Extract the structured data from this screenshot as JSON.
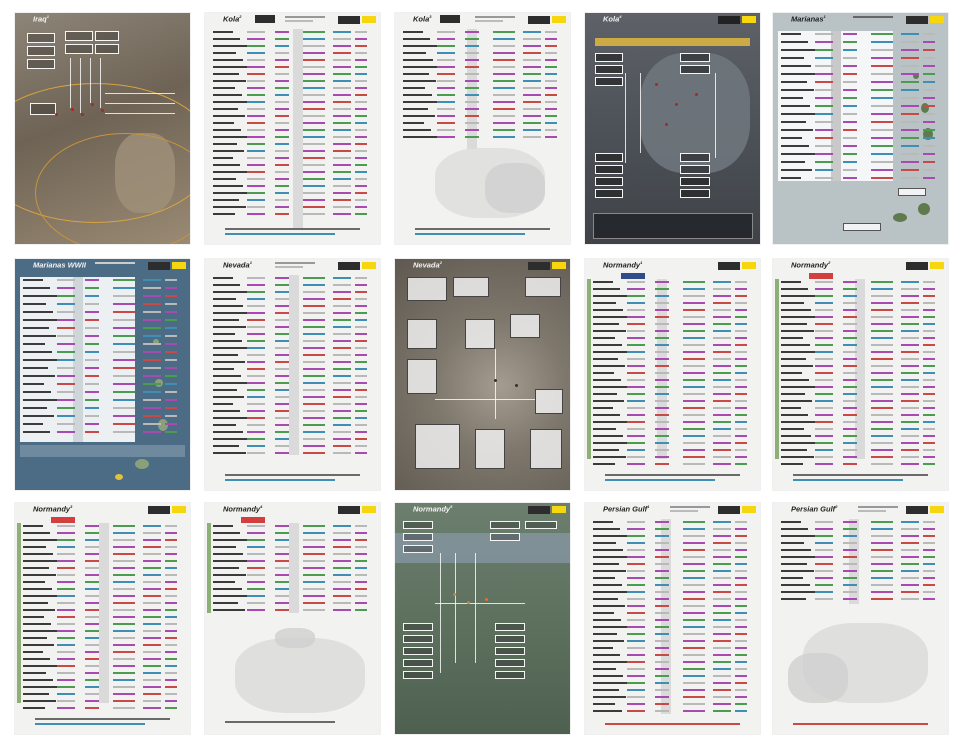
{
  "pages": [
    {
      "num": "",
      "title": "Iraq",
      "mark": "1",
      "flag": ""
    },
    {
      "num": "",
      "title": "Kola",
      "mark": "2",
      "flag": ""
    },
    {
      "num": "",
      "title": "Kola",
      "mark": "3",
      "flag": ""
    },
    {
      "num": "",
      "title": "Kola",
      "mark": "4",
      "flag": ""
    },
    {
      "num": "",
      "title": "Marianas",
      "mark": "1",
      "flag": ""
    },
    {
      "num": "",
      "title": "Marianas WWII",
      "mark": "",
      "flag": ""
    },
    {
      "num": "",
      "title": "Nevada",
      "mark": "1",
      "flag": ""
    },
    {
      "num": "",
      "title": "Nevada",
      "mark": "2",
      "flag": ""
    },
    {
      "num": "",
      "title": "Normandy",
      "mark": "1",
      "flag": "England"
    },
    {
      "num": "",
      "title": "Normandy",
      "mark": "2",
      "flag": "France"
    },
    {
      "num": "",
      "title": "Normandy",
      "mark": "3",
      "flag": "France"
    },
    {
      "num": "",
      "title": "Normandy",
      "mark": "4",
      "flag": "France"
    },
    {
      "num": "",
      "title": "Normandy",
      "mark": "5",
      "flag": ""
    },
    {
      "num": "",
      "title": "Persian Gulf",
      "mark": "1",
      "flag": ""
    },
    {
      "num": "",
      "title": "Persian Gulf",
      "mark": "2",
      "flag": ""
    }
  ],
  "colors": {
    "accent_yellow": "#f5d60f",
    "magnetic_purple": "#a74bb0",
    "green": "#4d9a53",
    "cyan": "#3e8fb3",
    "red": "#c94848"
  }
}
